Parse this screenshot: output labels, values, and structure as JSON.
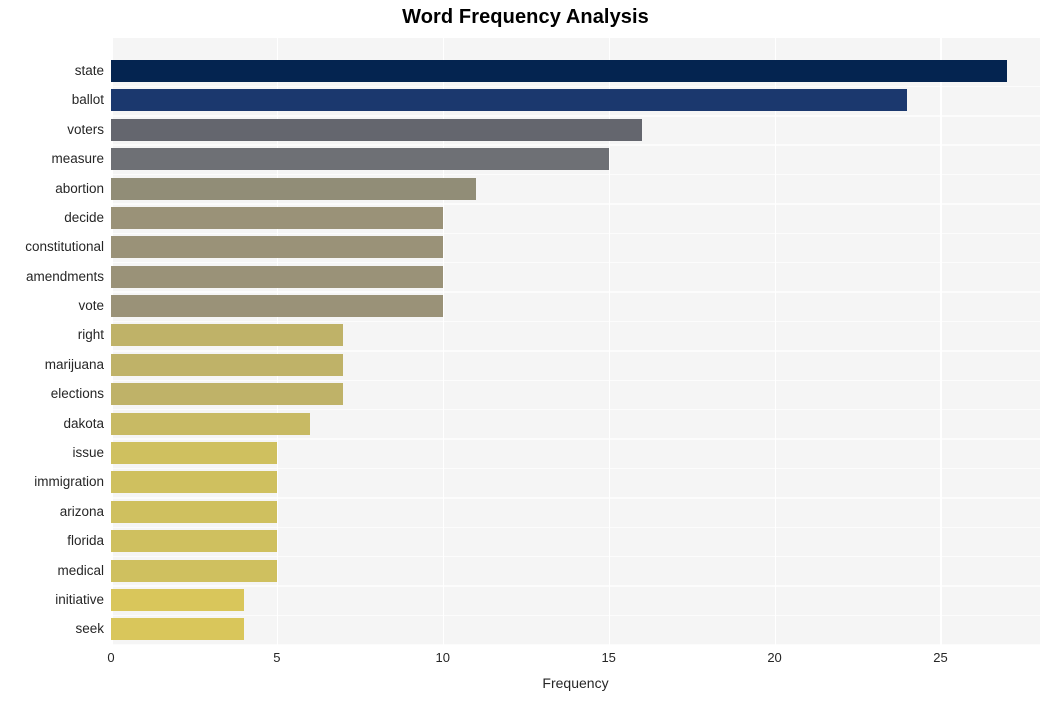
{
  "chart_data": {
    "type": "bar",
    "orientation": "horizontal",
    "title": "Word Frequency Analysis",
    "xlabel": "Frequency",
    "ylabel": "",
    "xlim": [
      0,
      28
    ],
    "ylim": null,
    "grid": true,
    "legend": null,
    "xticks": [
      0,
      5,
      10,
      15,
      20,
      25
    ],
    "xticklabels": [
      "0",
      "5",
      "10",
      "15",
      "20",
      "25"
    ],
    "categories": [
      "state",
      "ballot",
      "voters",
      "measure",
      "abortion",
      "decide",
      "constitutional",
      "amendments",
      "vote",
      "right",
      "marijuana",
      "elections",
      "dakota",
      "issue",
      "immigration",
      "arizona",
      "florida",
      "medical",
      "initiative",
      "seek"
    ],
    "values": [
      27,
      24,
      16,
      15,
      11,
      10,
      10,
      10,
      10,
      7,
      7,
      7,
      6,
      5,
      5,
      5,
      5,
      5,
      4,
      4
    ],
    "bar_colors": [
      "#042450",
      "#1b386e",
      "#64666e",
      "#6e7075",
      "#918d77",
      "#9a9278",
      "#9a9278",
      "#9a9278",
      "#9a9278",
      "#bfb268",
      "#bfb268",
      "#bfb268",
      "#c8ba64",
      "#cfc05f",
      "#cfc05f",
      "#cfc05f",
      "#cfc05f",
      "#cfc05f",
      "#d9c65b",
      "#d9c65b"
    ]
  },
  "style": {
    "plot_background": "#f5f5f5",
    "page_background": "#ffffff",
    "gridline_color": "#ffffff",
    "text_color": "#262626",
    "title_color": "#000000"
  }
}
